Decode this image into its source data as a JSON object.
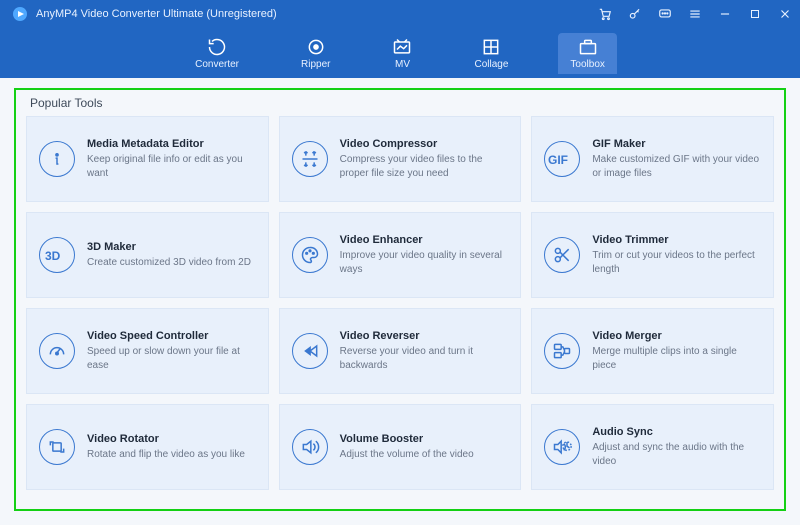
{
  "app": {
    "title": "AnyMP4 Video Converter Ultimate (Unregistered)"
  },
  "tabs": [
    {
      "label": "Converter"
    },
    {
      "label": "Ripper"
    },
    {
      "label": "MV"
    },
    {
      "label": "Collage"
    },
    {
      "label": "Toolbox"
    }
  ],
  "active_tab": 4,
  "section_title": "Popular Tools",
  "tools": [
    {
      "icon": "info",
      "title": "Media Metadata Editor",
      "desc": "Keep original file info or edit as you want"
    },
    {
      "icon": "compress",
      "title": "Video Compressor",
      "desc": "Compress your video files to the proper file size you need"
    },
    {
      "icon": "gif",
      "title": "GIF Maker",
      "desc": "Make customized GIF with your video or image files"
    },
    {
      "icon": "3d",
      "title": "3D Maker",
      "desc": "Create customized 3D video from 2D"
    },
    {
      "icon": "palette",
      "title": "Video Enhancer",
      "desc": "Improve your video quality in several ways"
    },
    {
      "icon": "scissors",
      "title": "Video Trimmer",
      "desc": "Trim or cut your videos to the perfect length"
    },
    {
      "icon": "speed",
      "title": "Video Speed Controller",
      "desc": "Speed up or slow down your file at ease"
    },
    {
      "icon": "reverse",
      "title": "Video Reverser",
      "desc": "Reverse your video and turn it backwards"
    },
    {
      "icon": "merge",
      "title": "Video Merger",
      "desc": "Merge multiple clips into a single piece"
    },
    {
      "icon": "rotate",
      "title": "Video Rotator",
      "desc": "Rotate and flip the video as you like"
    },
    {
      "icon": "volume",
      "title": "Volume Booster",
      "desc": "Adjust the volume of the video"
    },
    {
      "icon": "sync",
      "title": "Audio Sync",
      "desc": "Adjust and sync the audio with the video"
    }
  ]
}
